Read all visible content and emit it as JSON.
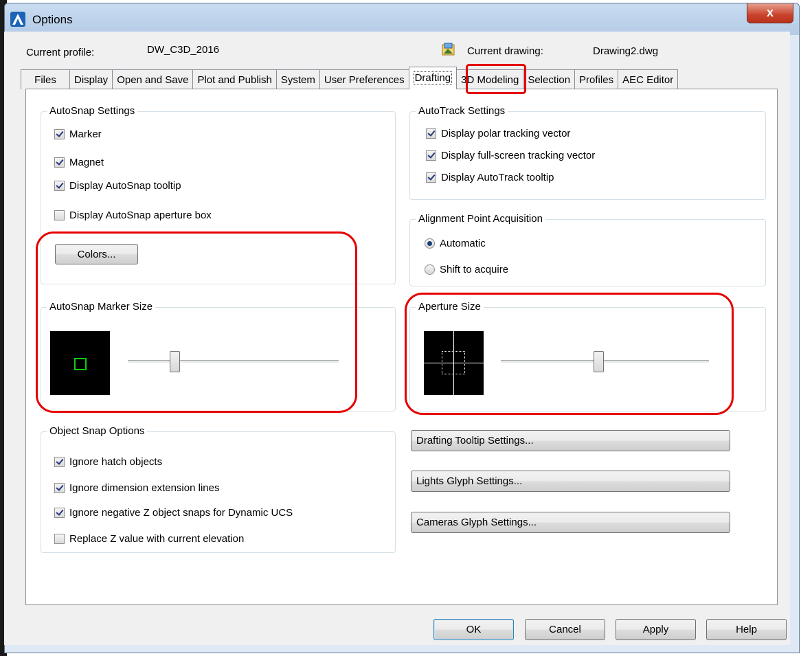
{
  "window": {
    "title": "Options",
    "close_label": "x",
    "current_profile_label": "Current profile:",
    "current_profile_value": "DW_C3D_2016",
    "current_drawing_label": "Current drawing:",
    "current_drawing_value": "Drawing2.dwg"
  },
  "tabs": [
    "Files",
    "Display",
    "Open and Save",
    "Plot and Publish",
    "System",
    "User Preferences",
    "Drafting",
    "3D Modeling",
    "Selection",
    "Profiles",
    "AEC Editor"
  ],
  "active_tab": "Drafting",
  "autosnap": {
    "title": "AutoSnap Settings",
    "marker": "Marker",
    "magnet": "Magnet",
    "tooltip": "Display AutoSnap tooltip",
    "aperture_box": "Display AutoSnap aperture box",
    "colors_button": "Colors..."
  },
  "marker_size": {
    "title": "AutoSnap Marker Size",
    "slider_fraction": 0.23
  },
  "object_snap": {
    "title": "Object Snap Options",
    "ignore_hatch": "Ignore hatch objects",
    "ignore_dim": "Ignore dimension extension lines",
    "ignore_negative_z": "Ignore negative Z object snaps for Dynamic UCS",
    "replace_z": "Replace Z value with current elevation"
  },
  "autotrack": {
    "title": "AutoTrack Settings",
    "polar": "Display polar tracking vector",
    "fullscreen": "Display full-screen tracking vector",
    "tooltip": "Display AutoTrack tooltip"
  },
  "alignment": {
    "title": "Alignment Point Acquisition",
    "automatic": "Automatic",
    "shift": "Shift to acquire"
  },
  "aperture": {
    "title": "Aperture Size",
    "slider_fraction": 0.47
  },
  "buttons": {
    "drafting_tooltip": "Drafting Tooltip Settings...",
    "lights_glyph": "Lights Glyph Settings...",
    "cameras_glyph": "Cameras Glyph Settings...",
    "ok": "OK",
    "cancel": "Cancel",
    "apply": "Apply",
    "help": "Help"
  },
  "colors": {
    "highlight": "#e60000",
    "marker": "#14c814",
    "preview_bg": "#000000"
  }
}
